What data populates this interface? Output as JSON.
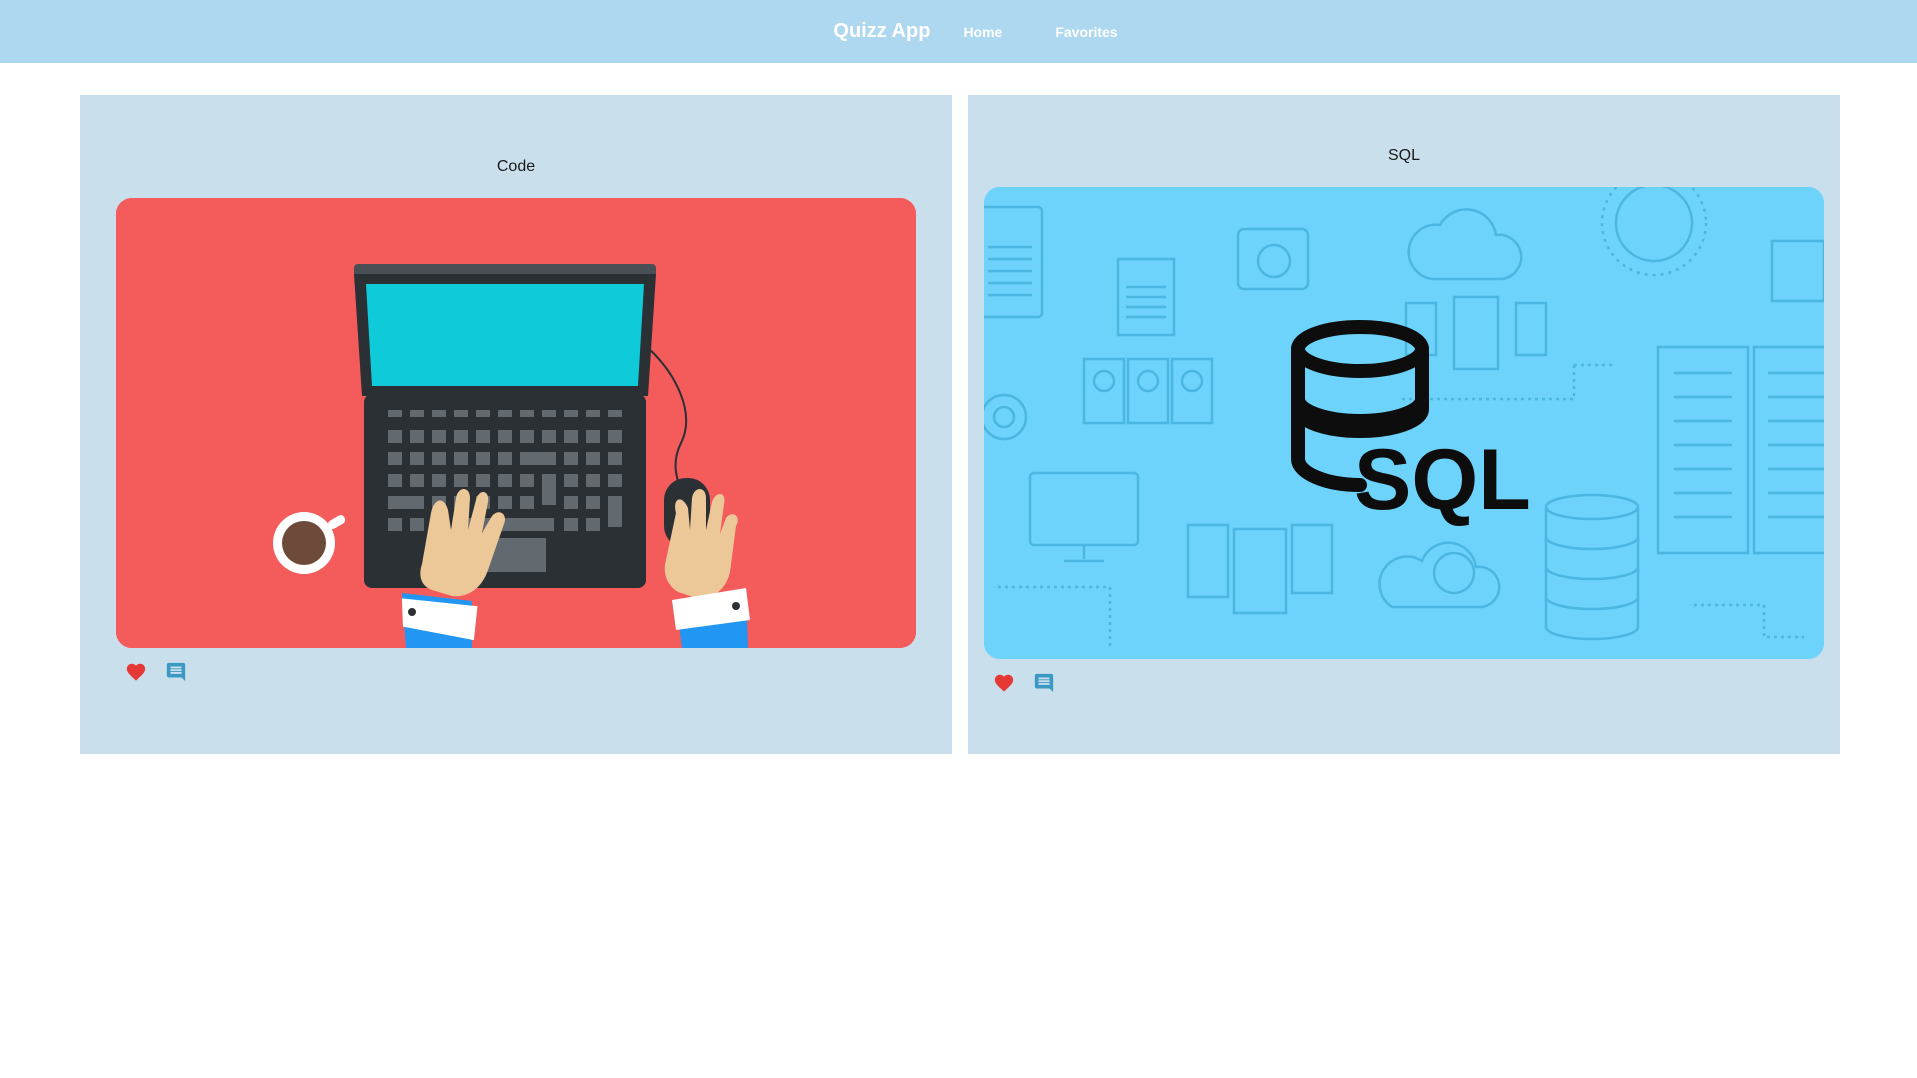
{
  "nav": {
    "brand": "Quizz App",
    "links": [
      "Home",
      "Favorites"
    ]
  },
  "cards": [
    {
      "title": "Code",
      "image_icon": "laptop-coding-illustration",
      "actions": [
        "heart-icon",
        "comment-icon"
      ]
    },
    {
      "title": "SQL",
      "image_icon": "sql-database-illustration",
      "image_text": "SQL",
      "actions": [
        "heart-icon",
        "comment-icon"
      ]
    }
  ],
  "colors": {
    "navbar": "#aed8f0",
    "card_background": "#c9dfec",
    "code_image_bg": "#f45b5b",
    "sql_image_bg": "#6dd3fb",
    "favorite": "#e53935",
    "comment": "#3a9ac4"
  }
}
